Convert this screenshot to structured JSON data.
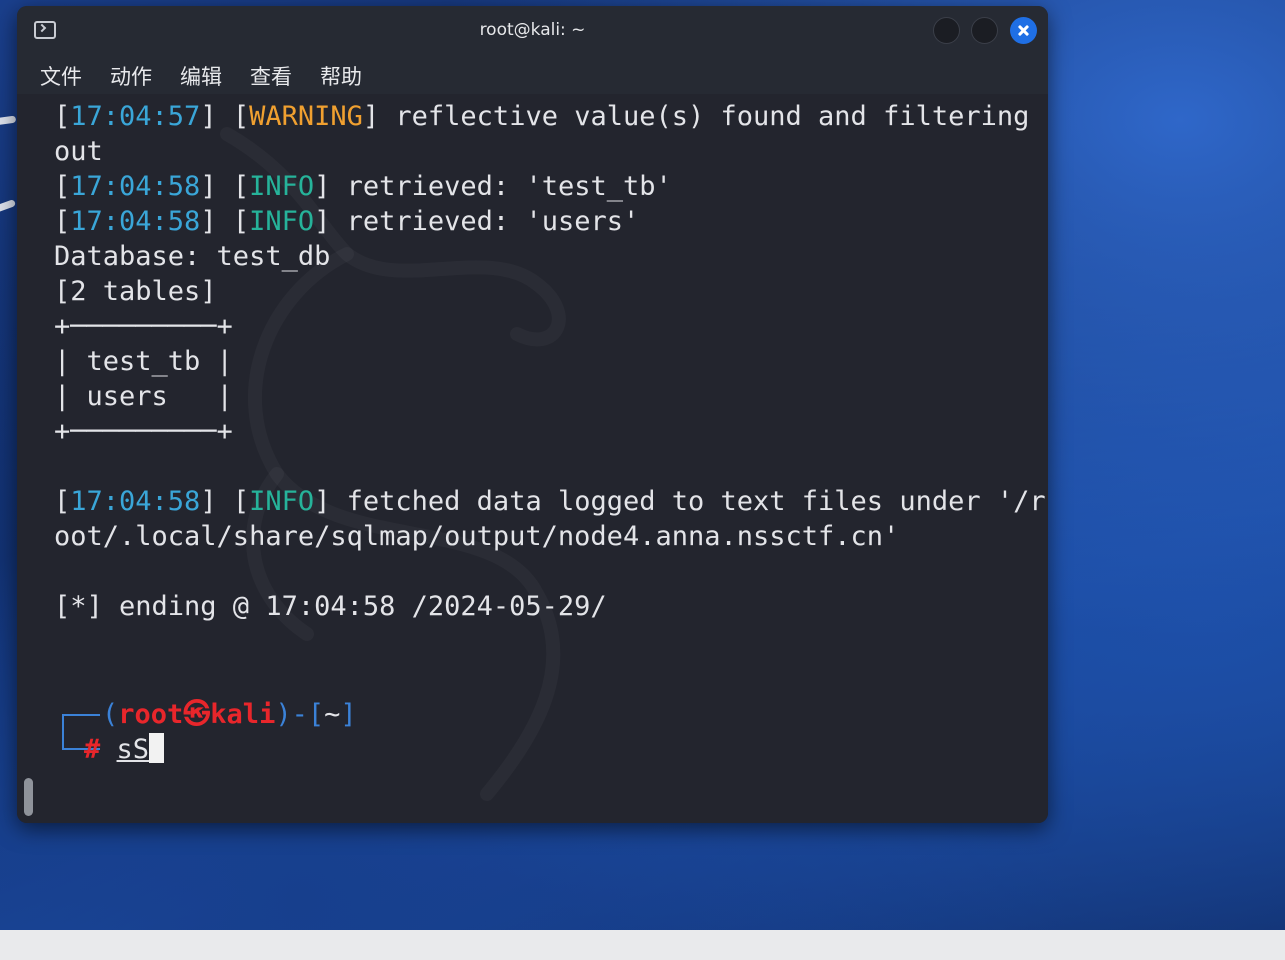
{
  "window": {
    "title": "root@kali: ~"
  },
  "menu": {
    "items": [
      "文件",
      "动作",
      "编辑",
      "查看",
      "帮助"
    ]
  },
  "terminal": {
    "lines": [
      [
        {
          "t": "["
        },
        {
          "t": "17:04:57",
          "c": "ts"
        },
        {
          "t": "] ["
        },
        {
          "t": "WARNING",
          "c": "warn"
        },
        {
          "t": "] reflective value(s) found and filtering"
        }
      ],
      [
        {
          "t": "out"
        }
      ],
      [
        {
          "t": "["
        },
        {
          "t": "17:04:58",
          "c": "ts"
        },
        {
          "t": "] ["
        },
        {
          "t": "INFO",
          "c": "info"
        },
        {
          "t": "] retrieved: 'test_tb'"
        }
      ],
      [
        {
          "t": "["
        },
        {
          "t": "17:04:58",
          "c": "ts"
        },
        {
          "t": "] ["
        },
        {
          "t": "INFO",
          "c": "info"
        },
        {
          "t": "] retrieved: 'users'"
        }
      ],
      [
        {
          "t": "Database: test_db"
        }
      ],
      [
        {
          "t": "[2 tables]"
        }
      ],
      [
        {
          "t": "+─────────+"
        }
      ],
      [
        {
          "t": "| test_tb |"
        }
      ],
      [
        {
          "t": "| users   |"
        }
      ],
      [
        {
          "t": "+─────────+"
        }
      ],
      [
        {
          "t": ""
        }
      ],
      [
        {
          "t": "["
        },
        {
          "t": "17:04:58",
          "c": "ts"
        },
        {
          "t": "] ["
        },
        {
          "t": "INFO",
          "c": "info"
        },
        {
          "t": "] fetched data logged to text files under '/r"
        }
      ],
      [
        {
          "t": "oot/.local/share/sqlmap/output/node4.anna.nssctf.cn'"
        }
      ],
      [
        {
          "t": ""
        }
      ],
      [
        {
          "t": "[*] ending @ 17:04:58 /2024-05-29/"
        }
      ]
    ],
    "prompt": {
      "open": "(",
      "user": "root",
      "at": "㉿",
      "host": "kali",
      "close": ")-[",
      "cwd": "~",
      "end": "]",
      "hash": "#",
      "command": "sS"
    }
  },
  "colors": {
    "timestamp": "#3aa6d8",
    "warning": "#f0a030",
    "info": "#26b39a",
    "prompt_red": "#e8262b",
    "prompt_blue": "#3b82d8",
    "close_button": "#1f6fe5"
  },
  "icons": [
    "terminal-icon",
    "minimize-button",
    "maximize-button",
    "close-icon"
  ]
}
